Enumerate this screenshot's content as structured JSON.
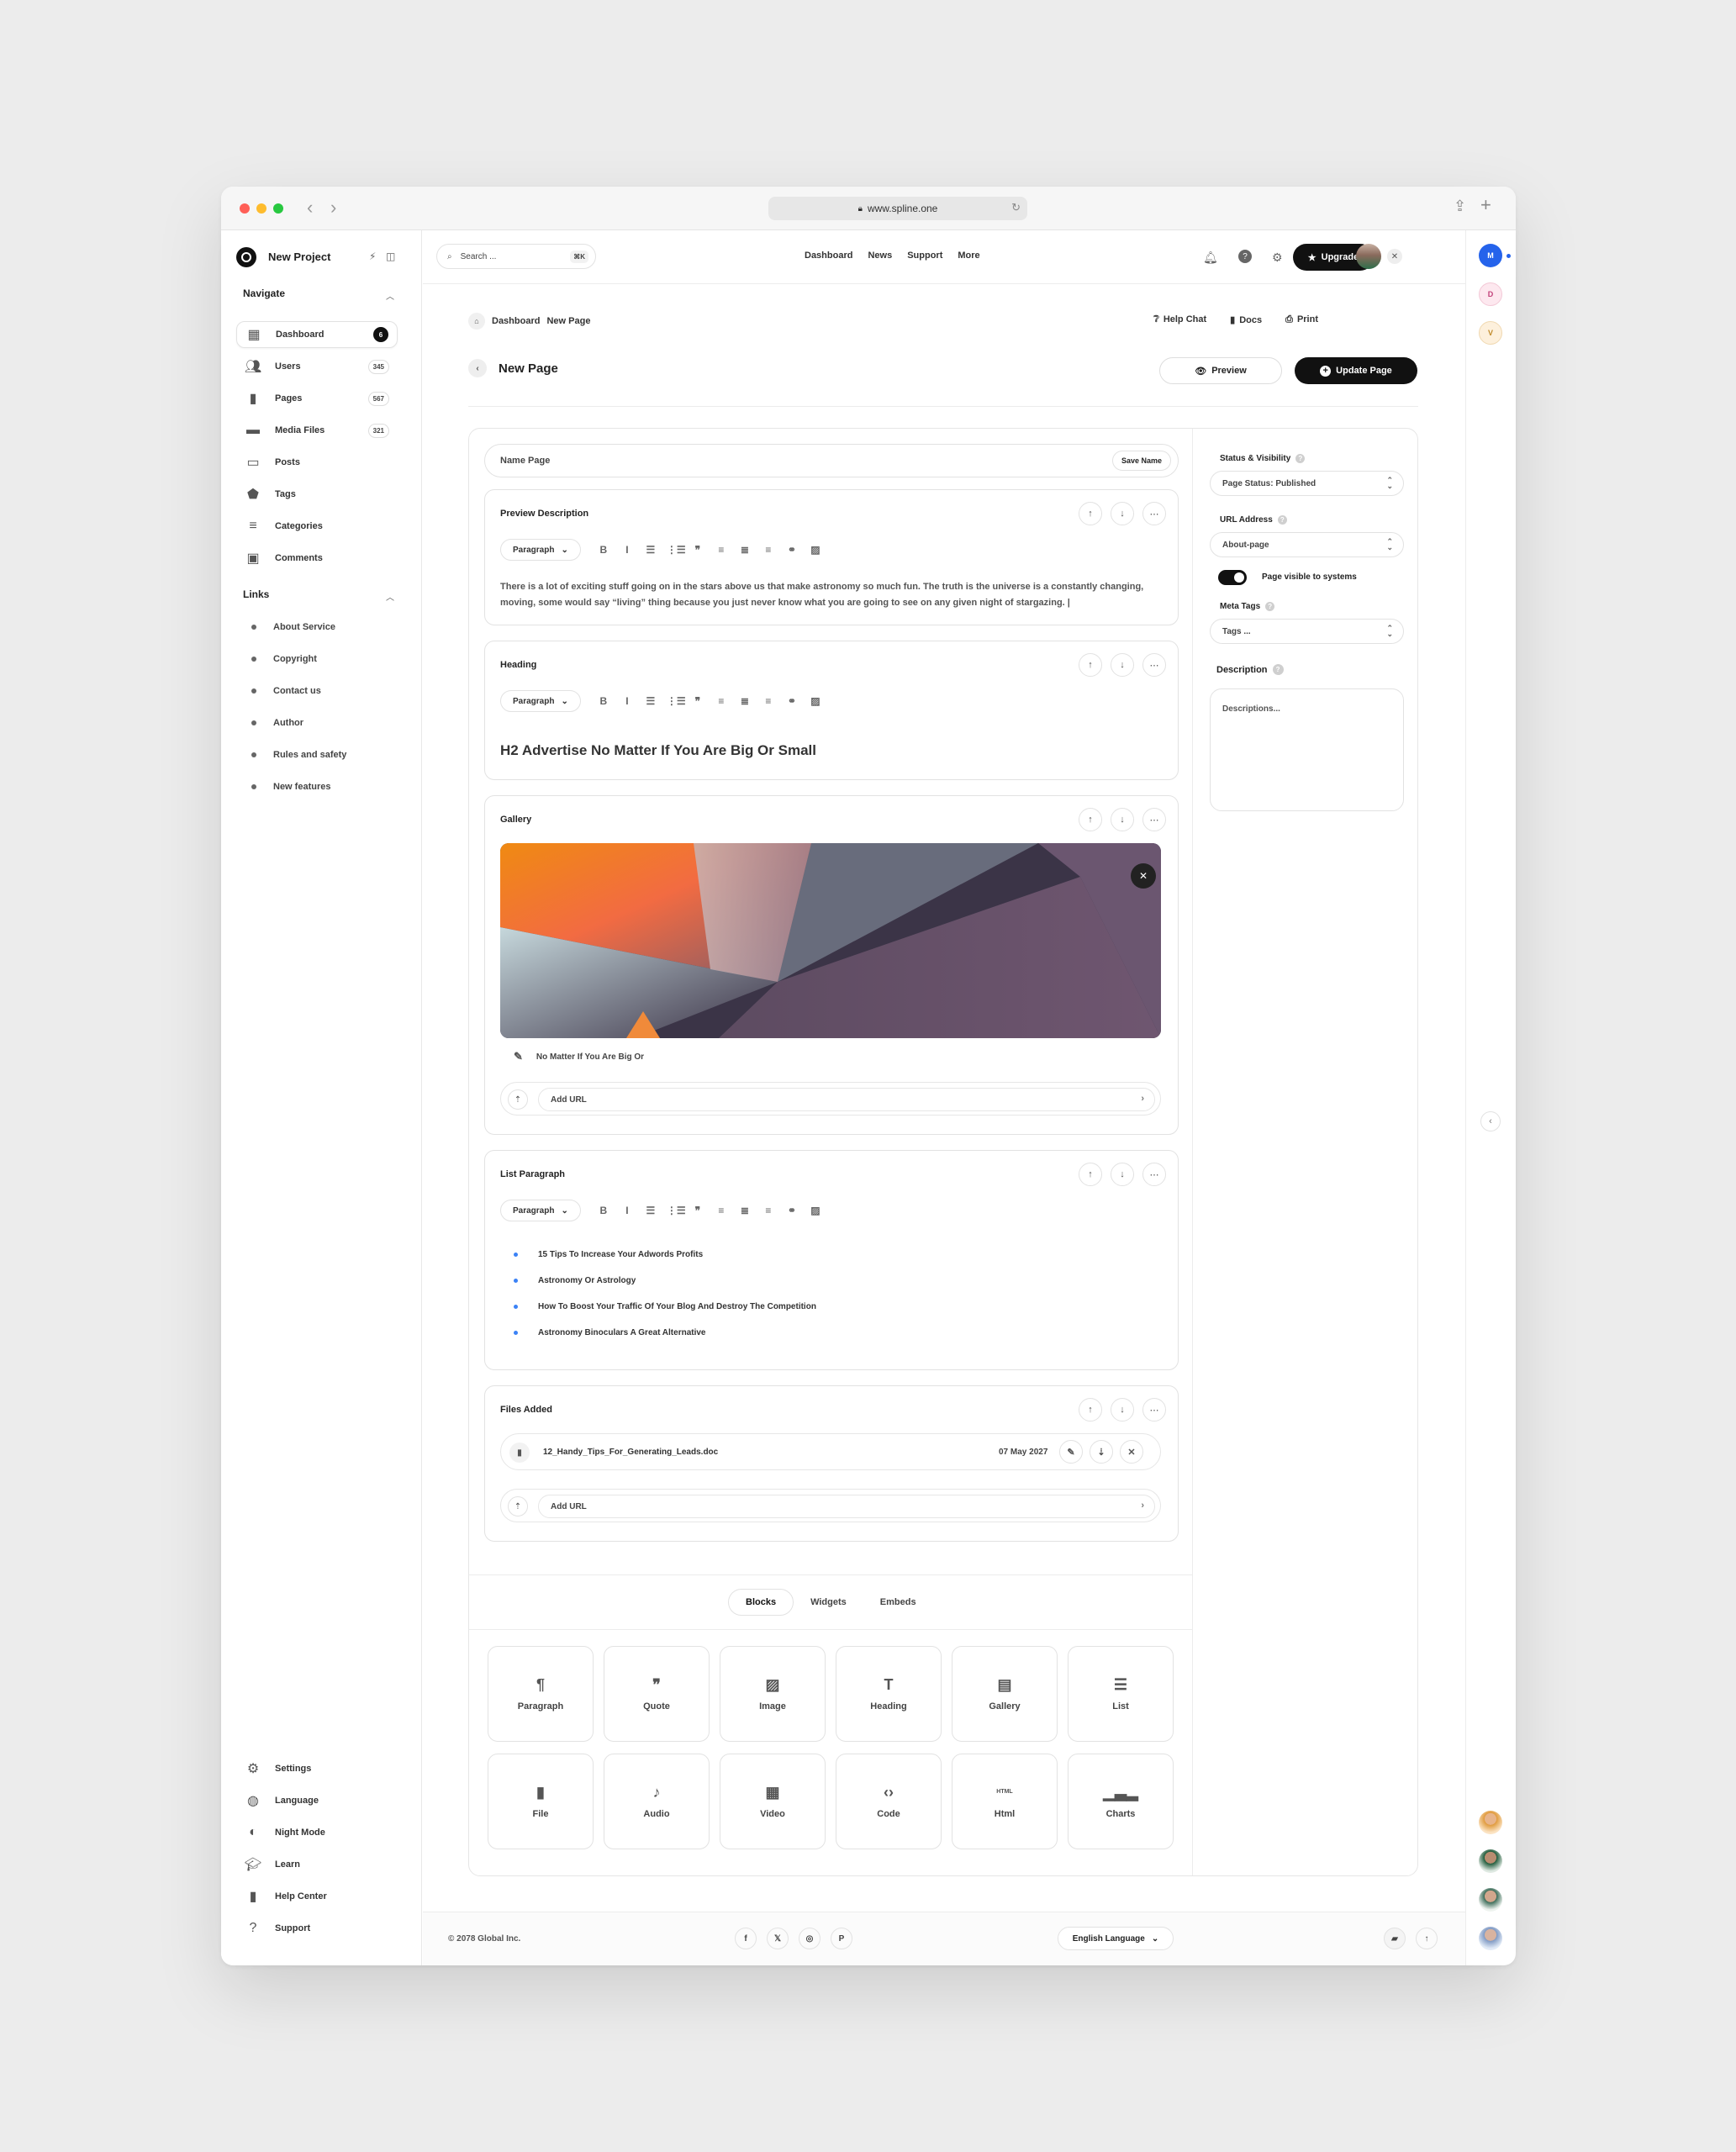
{
  "browser": {
    "url": "www.spline.one"
  },
  "sidebar": {
    "project": "New Project",
    "navigate_title": "Navigate",
    "nav": [
      {
        "label": "Dashboard",
        "badge": "6",
        "icon": "dashboard-icon"
      },
      {
        "label": "Users",
        "badge": "345",
        "icon": "users-icon"
      },
      {
        "label": "Pages",
        "badge": "567",
        "icon": "page-icon"
      },
      {
        "label": "Media Files",
        "badge": "321",
        "icon": "folder-icon"
      },
      {
        "label": "Posts",
        "badge": "",
        "icon": "chat-icon"
      },
      {
        "label": "Tags",
        "badge": "",
        "icon": "tag-icon"
      },
      {
        "label": "Categories",
        "badge": "",
        "icon": "sort-icon"
      },
      {
        "label": "Comments",
        "badge": "",
        "icon": "comments-icon"
      }
    ],
    "links_title": "Links",
    "links": [
      "About Service",
      "Copyright",
      "Contact us",
      "Author",
      "Rules and safety",
      "New features"
    ],
    "bottom": [
      {
        "label": "Settings",
        "icon": "gear-icon"
      },
      {
        "label": "Language",
        "icon": "globe-icon"
      },
      {
        "label": "Night Mode",
        "icon": "moon-icon"
      },
      {
        "label": "Learn",
        "icon": "graduation-cap-icon"
      },
      {
        "label": "Help Center",
        "icon": "document-icon"
      },
      {
        "label": "Support",
        "icon": "help-icon"
      }
    ]
  },
  "topnav": {
    "search_placeholder": "Search ...",
    "search_shortcut": "⌘K",
    "links": [
      "Dashboard",
      "News",
      "Support",
      "More"
    ],
    "upgrade": "Upgrade"
  },
  "rail": {
    "avatars": [
      "M",
      "D",
      "V"
    ]
  },
  "page": {
    "breadcrumb": [
      "Dashboard",
      "New Page"
    ],
    "header_links": [
      "Help Chat",
      "Docs",
      "Print"
    ],
    "title": "New Page",
    "preview": "Preview",
    "update": "Update Page"
  },
  "editor": {
    "name_placeholder": "Name Page",
    "save_name": "Save Name",
    "paragraph_select": "Paragraph",
    "preview_block": {
      "title": "Preview Description",
      "text": "There is a lot of exciting stuff going on in the stars above us that make astronomy so much fun. The truth is the universe is a constantly changing, moving, some would say “living” thing because you just never know what you are going to see on any given night of stargazing. |"
    },
    "heading_block": {
      "title": "Heading",
      "text": "H2 Advertise No Matter If You Are Big Or Small"
    },
    "gallery_block": {
      "title": "Gallery",
      "caption": "No Matter If You Are Big Or",
      "add_url": "Add URL"
    },
    "list_block": {
      "title": "List Paragraph",
      "items": [
        "15 Tips To Increase Your Adwords Profits",
        "Astronomy Or Astrology",
        "How To Boost Your Traffic Of Your Blog And Destroy The Competition",
        "Astronomy Binoculars A Great Alternative"
      ]
    },
    "files_block": {
      "title": "Files Added",
      "file_name": "12_Handy_Tips_For_Generating_Leads.doc",
      "file_date": "07 May 2027",
      "add_url": "Add URL"
    },
    "tabs": [
      "Blocks",
      "Widgets",
      "Embeds"
    ],
    "blocks": [
      {
        "label": "Paragraph",
        "icon": "¶"
      },
      {
        "label": "Quote",
        "icon": "❞"
      },
      {
        "label": "Image",
        "icon": "▨"
      },
      {
        "label": "Heading",
        "icon": "T"
      },
      {
        "label": "Gallery",
        "icon": "▤"
      },
      {
        "label": "List",
        "icon": "☰"
      },
      {
        "label": "File",
        "icon": "▮"
      },
      {
        "label": "Audio",
        "icon": "♪"
      },
      {
        "label": "Video",
        "icon": "▦"
      },
      {
        "label": "Code",
        "icon": "‹›"
      },
      {
        "label": "Html",
        "icon": "HTML"
      },
      {
        "label": "Charts",
        "icon": "▁▃▂"
      }
    ]
  },
  "settings": {
    "status_label": "Status & Visibility",
    "status_value": "Page Status: Published",
    "url_label": "URL Address",
    "url_value": "About-page",
    "visible_label": "Page visible to systems",
    "meta_label": "Meta Tags",
    "meta_placeholder": "Tags ...",
    "desc_label": "Description",
    "desc_placeholder": "Descriptions..."
  },
  "footer": {
    "copyright": "© 2078 Global Inc.",
    "social": [
      "f",
      "𝕏",
      "◎",
      "P"
    ],
    "language": "English Language"
  }
}
